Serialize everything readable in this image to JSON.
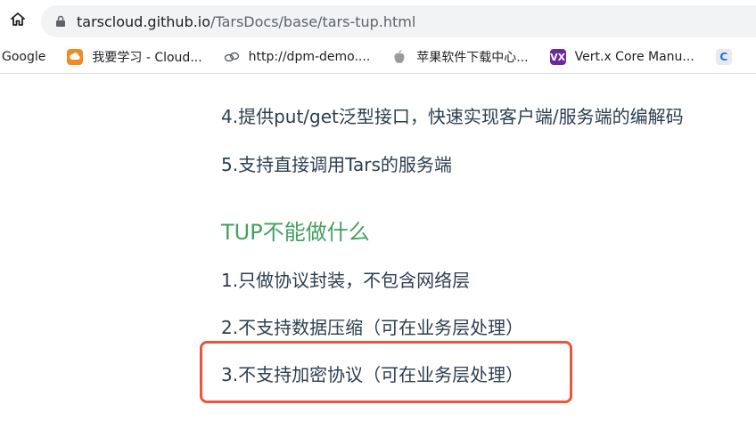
{
  "browser": {
    "url_host": "tarscloud.github.io",
    "url_path": "/TarsDocs/base/tars-tup.html"
  },
  "bookmarks": [
    {
      "label": "Google",
      "icon": "google-icon"
    },
    {
      "label": "我要学习 - Cloud...",
      "icon": "cloud-icon"
    },
    {
      "label": "http://dpm-demo....",
      "icon": "link-icon"
    },
    {
      "label": "苹果软件下载中心...",
      "icon": "apple-icon"
    },
    {
      "label": "Vert.x Core Manu...",
      "icon": "vertx-icon"
    },
    {
      "label": "",
      "icon": "c-icon"
    }
  ],
  "content": {
    "item_4": "4.提供put/get泛型接口，快速实现客户端/服务端的编解码",
    "item_5": "5.支持直接调用Tars的服务端",
    "heading": "TUP不能做什么",
    "not_1": "1.只做协议封装，不包含网络层",
    "not_2": "2.不支持数据压缩（可在业务层处理）",
    "not_3": "3.不支持加密协议（可在业务层处理）"
  },
  "colors": {
    "heading": "#42a061",
    "text": "#2c3e50",
    "highlight": "#e8573a"
  }
}
